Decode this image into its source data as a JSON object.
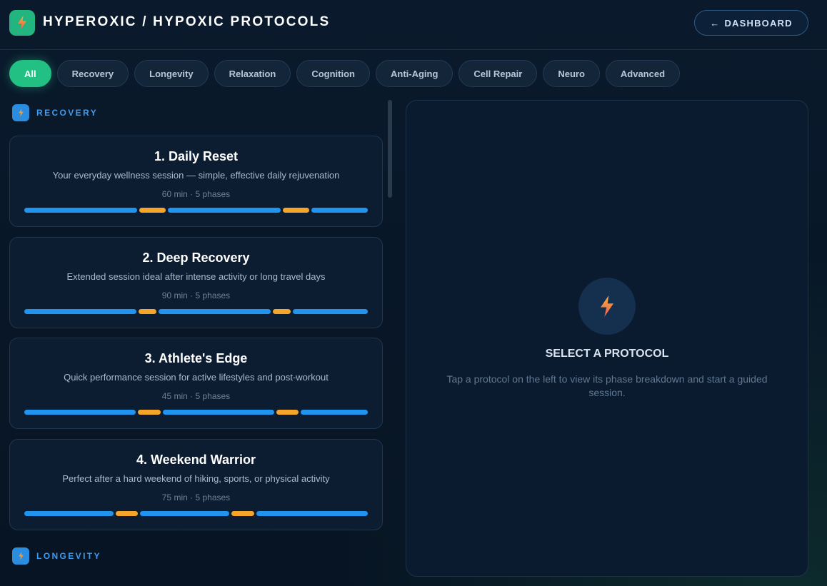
{
  "header": {
    "title": "HYPEROXIC / HYPOXIC PROTOCOLS",
    "dashboard_button": "DASHBOARD",
    "dashboard_arrow": "←"
  },
  "filters": [
    {
      "label": "All",
      "active": true
    },
    {
      "label": "Recovery",
      "active": false
    },
    {
      "label": "Longevity",
      "active": false
    },
    {
      "label": "Relaxation",
      "active": false
    },
    {
      "label": "Cognition",
      "active": false
    },
    {
      "label": "Anti-Aging",
      "active": false
    },
    {
      "label": "Cell Repair",
      "active": false
    },
    {
      "label": "Neuro",
      "active": false
    },
    {
      "label": "Advanced",
      "active": false
    }
  ],
  "sections": [
    {
      "label": "RECOVERY",
      "protocols": [
        {
          "title": "1. Daily Reset",
          "description": "Your everyday wellness session — simple, effective daily rejuvenation",
          "meta": "60 min · 5 phases",
          "phase_types": [
            "blue",
            "orange",
            "blue",
            "orange",
            "blue"
          ],
          "phase_weights": [
            15,
            3.5,
            15,
            3.5,
            7.5
          ]
        },
        {
          "title": "2. Deep Recovery",
          "description": "Extended session ideal after intense activity or long travel days",
          "meta": "90 min · 5 phases",
          "phase_types": [
            "blue",
            "orange",
            "blue",
            "orange",
            "blue"
          ],
          "phase_weights": [
            15,
            2.4,
            15,
            2.4,
            10
          ]
        },
        {
          "title": "3. Athlete's Edge",
          "description": "Quick performance session for active lifestyles and post-workout",
          "meta": "45 min · 5 phases",
          "phase_types": [
            "blue",
            "orange",
            "blue",
            "orange",
            "blue"
          ],
          "phase_weights": [
            15,
            3,
            15,
            3,
            9
          ]
        },
        {
          "title": "4. Weekend Warrior",
          "description": "Perfect after a hard weekend of hiking, sports, or physical activity",
          "meta": "75 min · 5 phases",
          "phase_types": [
            "blue",
            "orange",
            "blue",
            "orange",
            "blue"
          ],
          "phase_weights": [
            12,
            3,
            12,
            3,
            15
          ]
        }
      ]
    },
    {
      "label": "LONGEVITY",
      "protocols": []
    }
  ],
  "detail": {
    "title": "SELECT A PROTOCOL",
    "text": "Tap a protocol on the left to view its phase breakdown and start a guided session."
  },
  "colors": {
    "accent_green": "#23c084",
    "phase_blue": "#2094ee",
    "phase_orange": "#f5a52a",
    "section_blue": "#3d9bf0"
  },
  "icons": {
    "logo": "lightning-icon",
    "back": "arrow-left-icon"
  }
}
